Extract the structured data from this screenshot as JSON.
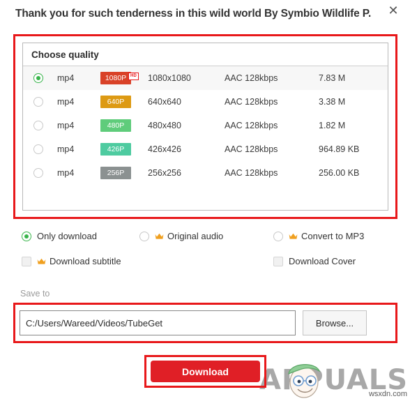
{
  "dialog": {
    "title": "Thank you for such tenderness in this wild world  By Symbio Wildlife P.",
    "close_icon": "close-icon"
  },
  "quality": {
    "header": "Choose quality",
    "hd_tag": "HD",
    "rows": [
      {
        "format": "mp4",
        "badge": "1080P",
        "badge_color": "#d94228",
        "resolution": "1080x1080",
        "audio": "AAC 128kbps",
        "size": "7.83 M",
        "selected": true,
        "hd": true
      },
      {
        "format": "mp4",
        "badge": "640P",
        "badge_color": "#dd9a13",
        "resolution": "640x640",
        "audio": "AAC 128kbps",
        "size": "3.38 M",
        "selected": false,
        "hd": false
      },
      {
        "format": "mp4",
        "badge": "480P",
        "badge_color": "#5fcc7b",
        "resolution": "480x480",
        "audio": "AAC 128kbps",
        "size": "1.82 M",
        "selected": false,
        "hd": false
      },
      {
        "format": "mp4",
        "badge": "426P",
        "badge_color": "#4ecba0",
        "resolution": "426x426",
        "audio": "AAC 128kbps",
        "size": "964.89 KB",
        "selected": false,
        "hd": false
      },
      {
        "format": "mp4",
        "badge": "256P",
        "badge_color": "#8b9191",
        "resolution": "256x256",
        "audio": "AAC 128kbps",
        "size": "256.00 KB",
        "selected": false,
        "hd": false
      }
    ]
  },
  "options": {
    "only_download": "Only download",
    "original_audio": "Original audio",
    "convert_mp3": "Convert to MP3",
    "download_subtitle": "Download subtitle",
    "download_cover": "Download Cover"
  },
  "save_to": {
    "label": "Save to",
    "path": "C:/Users/Wareed/Videos/TubeGet",
    "browse": "Browse..."
  },
  "actions": {
    "download": "Download"
  },
  "watermark": {
    "brand": "APPUALS",
    "site": "wsxdn.com"
  },
  "colors": {
    "annotation_red": "#e8181a",
    "download_red": "#e01f26",
    "radio_green": "#38b44a",
    "crown_orange": "#f0a020"
  }
}
